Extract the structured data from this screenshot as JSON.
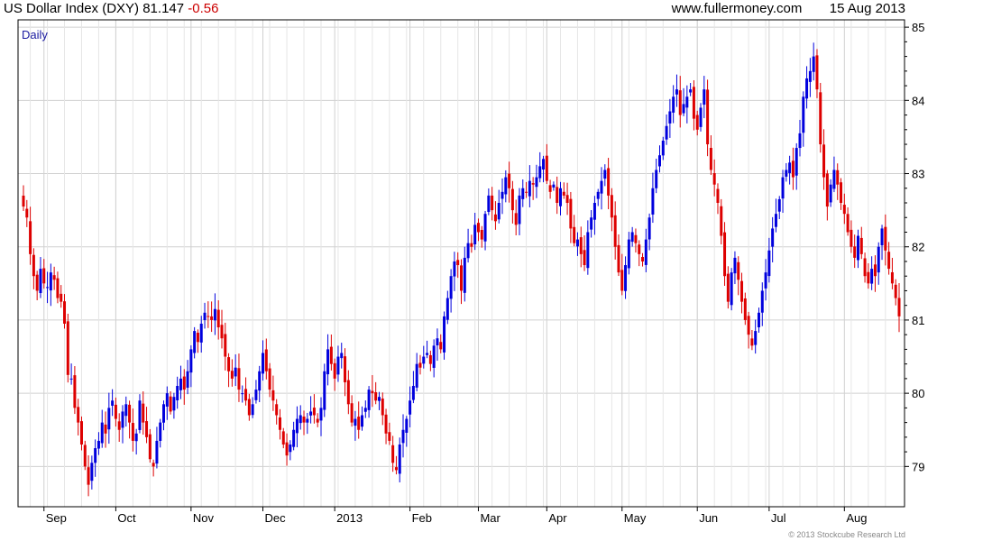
{
  "header": {
    "title": "US Dollar Index (DXY)",
    "last": "81.147",
    "change": "-0.56",
    "site": "www.fullermoney.com",
    "date": "15 Aug 2013"
  },
  "copyright": "© 2013 Stockcube Research Ltd",
  "colors": {
    "up": "#0000dd",
    "down": "#dd0000",
    "grid": "#d0d0d0",
    "frame": "#000000",
    "period_label": "#1a1aa0"
  },
  "chart_data": {
    "type": "candlestick",
    "period_label": "Daily",
    "ylim": [
      78.45,
      85.1
    ],
    "y_ticks": [
      79,
      80,
      81,
      82,
      83,
      84,
      85
    ],
    "y_axis_side": "right",
    "grid": true,
    "x_ticks": [
      {
        "label": "Sep",
        "index": 6
      },
      {
        "label": "Oct",
        "index": 27
      },
      {
        "label": "Nov",
        "index": 49
      },
      {
        "label": "Dec",
        "index": 70
      },
      {
        "label": "2013",
        "index": 91
      },
      {
        "label": "Feb",
        "index": 113
      },
      {
        "label": "Mar",
        "index": 133
      },
      {
        "label": "Apr",
        "index": 153
      },
      {
        "label": "May",
        "index": 175
      },
      {
        "label": "Jun",
        "index": 197
      },
      {
        "label": "Jul",
        "index": 218
      },
      {
        "label": "Aug",
        "index": 240
      }
    ],
    "close": [
      82.55,
      82.4,
      81.9,
      81.6,
      81.4,
      81.7,
      81.5,
      81.45,
      81.65,
      81.55,
      81.3,
      81.25,
      80.95,
      80.25,
      80.2,
      79.8,
      79.6,
      79.3,
      79.0,
      78.75,
      79.05,
      79.25,
      79.35,
      79.6,
      79.45,
      79.8,
      79.9,
      79.65,
      79.5,
      79.75,
      79.85,
      79.6,
      79.35,
      79.45,
      79.9,
      79.6,
      79.4,
      79.1,
      79.0,
      79.35,
      79.6,
      79.85,
      80.0,
      79.75,
      79.95,
      80.1,
      80.2,
      80.05,
      80.3,
      80.6,
      80.85,
      80.7,
      80.95,
      81.1,
      81.05,
      81.0,
      81.15,
      80.9,
      80.75,
      80.5,
      80.3,
      80.2,
      80.35,
      80.05,
      80.0,
      79.9,
      79.7,
      79.85,
      80.05,
      80.3,
      80.55,
      80.3,
      80.05,
      79.9,
      79.7,
      79.5,
      79.3,
      79.15,
      79.3,
      79.5,
      79.65,
      79.7,
      79.6,
      79.65,
      79.75,
      79.7,
      79.6,
      79.8,
      80.3,
      80.6,
      80.4,
      80.2,
      80.5,
      80.55,
      80.15,
      79.85,
      79.6,
      79.65,
      79.5,
      79.7,
      79.8,
      80.05,
      80.0,
      79.9,
      79.95,
      79.7,
      79.45,
      79.35,
      79.05,
      78.95,
      79.3,
      79.5,
      79.65,
      79.9,
      80.1,
      80.4,
      80.35,
      80.5,
      80.55,
      80.4,
      80.65,
      80.75,
      80.6,
      81.05,
      81.3,
      81.6,
      81.8,
      81.75,
      81.4,
      81.85,
      82.05,
      82.0,
      82.3,
      82.2,
      82.1,
      82.45,
      82.7,
      82.5,
      82.35,
      82.6,
      82.75,
      82.95,
      82.8,
      82.5,
      82.3,
      82.7,
      82.8,
      82.75,
      82.9,
      82.85,
      82.95,
      83.1,
      83.2,
      82.9,
      82.75,
      82.85,
      82.6,
      82.8,
      82.7,
      82.6,
      82.25,
      82.05,
      82.1,
      81.9,
      81.75,
      82.2,
      82.4,
      82.6,
      82.75,
      82.9,
      83.05,
      82.7,
      82.4,
      82.0,
      81.65,
      81.4,
      81.75,
      82.1,
      82.2,
      82.05,
      81.9,
      81.8,
      82.1,
      82.4,
      82.8,
      83.05,
      83.25,
      83.45,
      83.65,
      83.85,
      84.05,
      84.15,
      83.8,
      83.95,
      84.05,
      84.15,
      83.75,
      83.6,
      83.9,
      84.15,
      83.4,
      83.05,
      82.85,
      82.6,
      82.15,
      81.6,
      81.25,
      81.65,
      81.85,
      81.55,
      81.25,
      81.0,
      80.8,
      80.65,
      80.85,
      81.1,
      81.4,
      81.65,
      81.95,
      82.25,
      82.45,
      82.65,
      82.95,
      83.05,
      83.15,
      82.95,
      83.35,
      83.55,
      84.05,
      84.3,
      84.4,
      84.6,
      84.15,
      83.4,
      82.95,
      82.55,
      82.85,
      83.05,
      82.85,
      82.6,
      82.45,
      82.2,
      82.0,
      81.85,
      82.15,
      81.9,
      81.6,
      81.5,
      81.7,
      81.6,
      82.0,
      82.25,
      81.95,
      81.7,
      81.5,
      81.3,
      81.05,
      81.1,
      81.25,
      81.55,
      81.7,
      81.75,
      81.15
    ],
    "n_bars": 257
  }
}
